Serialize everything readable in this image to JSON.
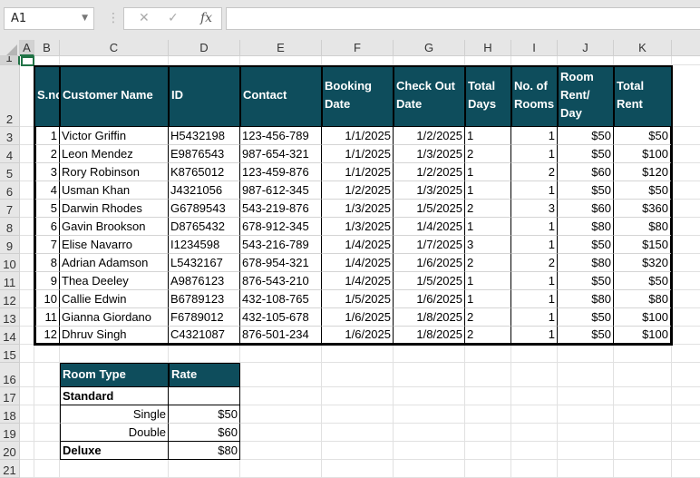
{
  "toolbar": {
    "name_box": "A1",
    "cancel_icon": "✕",
    "enter_icon": "✓",
    "fx_label": "fx",
    "formula": ""
  },
  "columns": [
    "A",
    "B",
    "C",
    "D",
    "E",
    "F",
    "G",
    "H",
    "I",
    "J",
    "K",
    ""
  ],
  "rows": [
    "1",
    "2",
    "3",
    "4",
    "5",
    "6",
    "7",
    "8",
    "9",
    "10",
    "11",
    "12",
    "13",
    "14",
    "15",
    "16",
    "17",
    "18",
    "19",
    "20",
    "21"
  ],
  "colors": {
    "header_fill": "#0e4d5c",
    "selection": "#217346"
  },
  "bookings": {
    "headers": [
      "S.no",
      "Customer Name",
      "ID",
      "Contact",
      "Booking Date",
      "Check Out Date",
      "Total Days",
      "No. of Rooms",
      "Room Rent/ Day",
      "Total Rent"
    ],
    "rows": [
      [
        "1",
        "Victor Griffin",
        "H5432198",
        "123-456-789",
        "1/1/2025",
        "1/2/2025",
        "1",
        "1",
        "$50",
        "$50"
      ],
      [
        "2",
        "Leon Mendez",
        "E9876543",
        "987-654-321",
        "1/1/2025",
        "1/3/2025",
        "2",
        "1",
        "$50",
        "$100"
      ],
      [
        "3",
        "Rory Robinson",
        "K8765012",
        "123-459-876",
        "1/1/2025",
        "1/2/2025",
        "1",
        "2",
        "$60",
        "$120"
      ],
      [
        "4",
        "Usman Khan",
        "J4321056",
        "987-612-345",
        "1/2/2025",
        "1/3/2025",
        "1",
        "1",
        "$50",
        "$50"
      ],
      [
        "5",
        "Darwin Rhodes",
        "G6789543",
        "543-219-876",
        "1/3/2025",
        "1/5/2025",
        "2",
        "3",
        "$60",
        "$360"
      ],
      [
        "6",
        "Gavin Brookson",
        "D8765432",
        "678-912-345",
        "1/3/2025",
        "1/4/2025",
        "1",
        "1",
        "$80",
        "$80"
      ],
      [
        "7",
        "Elise Navarro",
        "I1234598",
        "543-216-789",
        "1/4/2025",
        "1/7/2025",
        "3",
        "1",
        "$50",
        "$150"
      ],
      [
        "8",
        "Adrian Adamson",
        "L5432167",
        "678-954-321",
        "1/4/2025",
        "1/6/2025",
        "2",
        "2",
        "$80",
        "$320"
      ],
      [
        "9",
        "Thea Deeley",
        "A9876123",
        "876-543-210",
        "1/4/2025",
        "1/5/2025",
        "1",
        "1",
        "$50",
        "$50"
      ],
      [
        "10",
        "Callie Edwin",
        "B6789123",
        "432-108-765",
        "1/5/2025",
        "1/6/2025",
        "1",
        "1",
        "$80",
        "$80"
      ],
      [
        "11",
        "Gianna Giordano",
        "F6789012",
        "432-105-678",
        "1/6/2025",
        "1/8/2025",
        "2",
        "1",
        "$50",
        "$100"
      ],
      [
        "12",
        "Dhruv Singh",
        "C4321087",
        "876-501-234",
        "1/6/2025",
        "1/8/2025",
        "2",
        "1",
        "$50",
        "$100"
      ]
    ]
  },
  "rates": {
    "headers": [
      "Room Type",
      "Rate"
    ],
    "rows": [
      [
        "Standard",
        ""
      ],
      [
        "Single",
        "$50"
      ],
      [
        "Double",
        "$60"
      ],
      [
        "Deluxe",
        "$80"
      ]
    ]
  }
}
